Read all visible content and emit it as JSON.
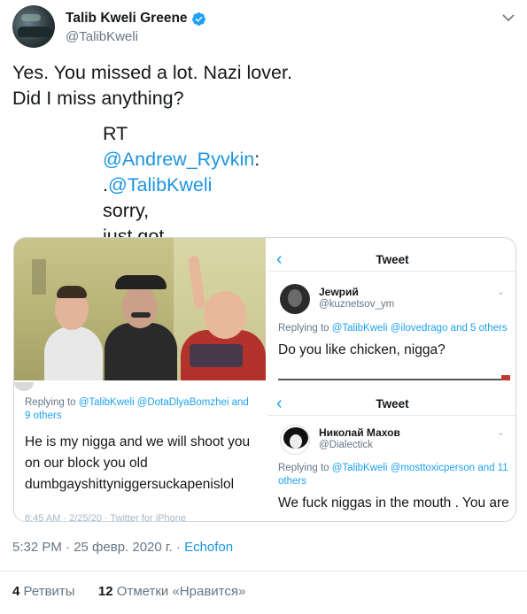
{
  "author": {
    "display_name": "Talib Kweli Greene",
    "handle": "@TalibKweli",
    "verified": true,
    "verified_color": "#1da1f2",
    "avatar_icon": "avatar-photo"
  },
  "tweet": {
    "line1": "Yes. You missed a lot. Nazi lover.",
    "rt_prefix": "RT ",
    "rt_mention": "@Andrew_Ryvkin",
    "rt_sep": ": .",
    "rt_mention2": "@TalibKweli",
    "rt_text": " sorry, just got back from our top-secret, all-Jewish nazi klan supremacy meeting.",
    "rt_last": "Did I miss anything?"
  },
  "media": {
    "q2": {
      "nav_title": "Tweet",
      "name": "Jewрий",
      "handle": "@kuznetsov_ym",
      "reply_prefix": "Replying to ",
      "reply_mentions": "@TalibKweli @ilovedrago and 5 others",
      "text": "Do you like chicken, nigga?"
    },
    "q3": {
      "reply_prefix": "Replying to ",
      "reply_mentions": "@TalibKweli @DotaDlyaBomzhei and 9 others",
      "text": "He is my nigga and we will shoot you on our block you old dumbgayshittyniggersuckapenislol",
      "footer": "8:45 AM · 2/25/20 · Twitter for iPhone"
    },
    "q4": {
      "nav_title": "Tweet",
      "name": "Николай Махов",
      "handle": "@Dialectick",
      "reply_prefix": "Replying to ",
      "reply_mentions": "@TalibKweli @mosttoxicperson and 11 others",
      "text": "We fuck niggas in the mouth . You are"
    }
  },
  "meta": {
    "time": "5:32 PM · 25 февр. 2020 г. · ",
    "source": "Echofon"
  },
  "stats": {
    "retweets_count": "4",
    "retweets_label": "Ретвиты",
    "likes_count": "12",
    "likes_label": "Отметки «Нравится»"
  },
  "colors": {
    "link": "#1b95e0",
    "text": "#14171a",
    "secondary": "#657786"
  }
}
